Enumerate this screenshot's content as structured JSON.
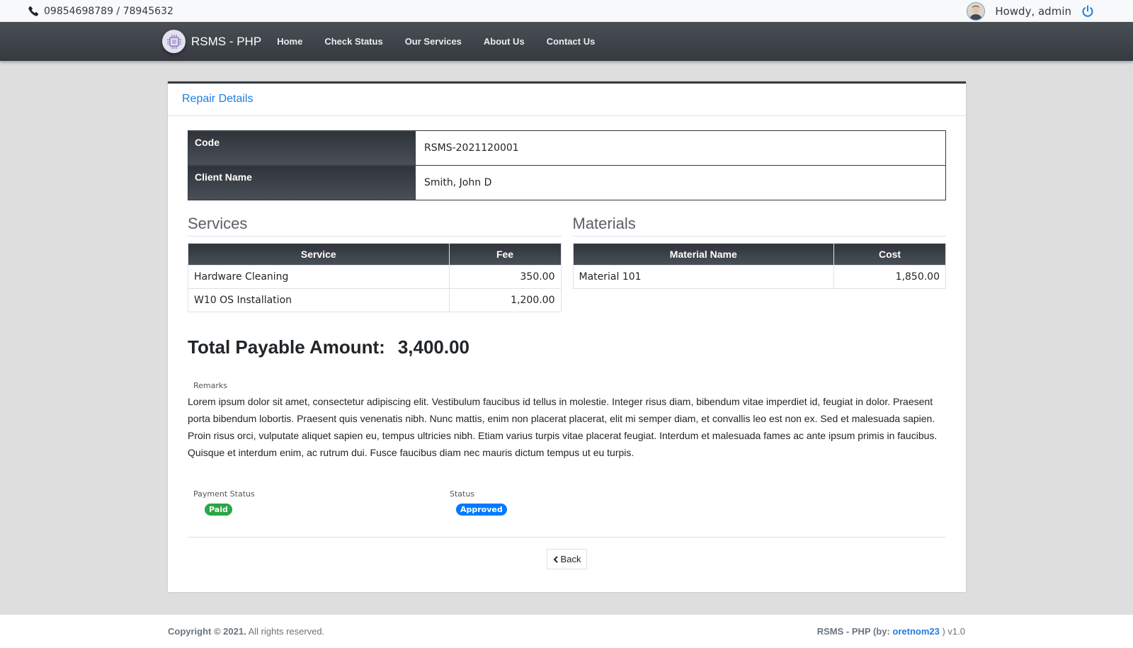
{
  "topbar": {
    "phone": "09854698789 / 78945632",
    "greeting": "Howdy, admin"
  },
  "navbar": {
    "brand": "RSMS - PHP",
    "links": [
      "Home",
      "Check Status",
      "Our Services",
      "About Us",
      "Contact Us"
    ]
  },
  "card": {
    "title": "Repair Details",
    "info": [
      {
        "label": "Code",
        "value": "RSMS-2021120001"
      },
      {
        "label": "Client Name",
        "value": "Smith, John D"
      }
    ],
    "services": {
      "heading": "Services",
      "headers": [
        "Service",
        "Fee"
      ],
      "rows": [
        [
          "Hardware Cleaning",
          "350.00"
        ],
        [
          "W10 OS Installation",
          "1,200.00"
        ]
      ]
    },
    "materials": {
      "heading": "Materials",
      "headers": [
        "Material Name",
        "Cost"
      ],
      "rows": [
        [
          "Material 101",
          "1,850.00"
        ]
      ]
    },
    "total_label": "Total Payable Amount:",
    "total_value": "3,400.00",
    "remarks_label": "Remarks",
    "remarks": "Lorem ipsum dolor sit amet, consectetur adipiscing elit. Vestibulum faucibus id tellus in molestie. Integer risus diam, bibendum vitae imperdiet id, feugiat in dolor. Praesent porta bibendum lobortis. Praesent quis venenatis nibh. Nunc mattis, enim non placerat placerat, elit mi semper diam, et convallis leo est non ex. Sed et malesuada sapien. Proin risus orci, vulputate aliquet sapien eu, tempus ultricies nibh. Etiam varius turpis vitae placerat feugiat. Interdum et malesuada fames ac ante ipsum primis in faucibus. Quisque et interdum enim, ac rutrum dui. Fusce faucibus diam nec mauris dictum tempus ut eu turpis.",
    "payment_status_label": "Payment Status",
    "payment_status": "Paid",
    "status_label": "Status",
    "status": "Approved",
    "back_label": "Back"
  },
  "footer": {
    "copyright_bold": "Copyright © 2021.",
    "copyright_rest": " All rights reserved.",
    "credit_prefix": "RSMS - PHP (by: ",
    "credit_author": "oretnom23",
    "credit_suffix": " ) v1.0"
  },
  "colors": {
    "accent": "#1f7de0",
    "dark": "#343a40",
    "paid": "#28a745",
    "approved": "#007bff"
  }
}
